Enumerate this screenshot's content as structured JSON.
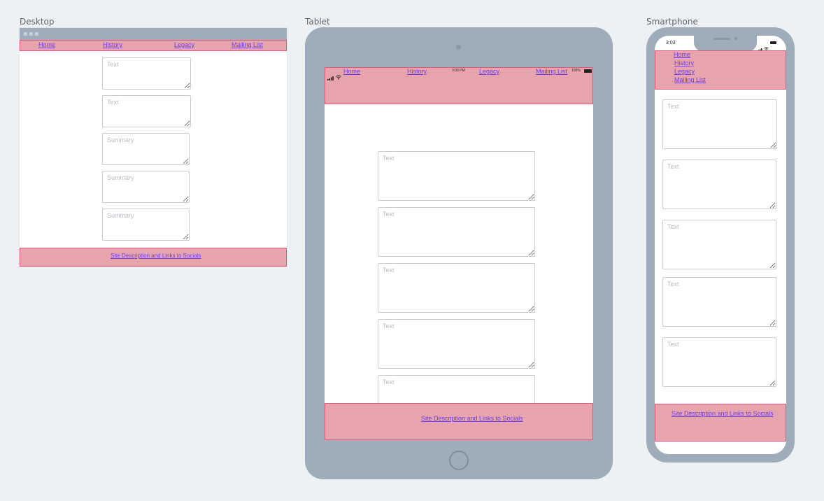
{
  "labels": {
    "desktop": "Desktop",
    "tablet": "Tablet",
    "smartphone": "Smartphone"
  },
  "nav": {
    "home": "Home",
    "history": "History",
    "legacy": "Legacy",
    "mailing_list": "Mailing List"
  },
  "footer_link": "Site Description and Links to Socials",
  "desktop": {
    "placeholders": [
      "Text",
      "Text",
      "Summary",
      "Summary",
      "Summary"
    ]
  },
  "tablet": {
    "status_time": "3:03 PM",
    "battery": "100%",
    "placeholders": [
      "Text",
      "Text",
      "Text",
      "Text",
      "Text"
    ]
  },
  "phone": {
    "status_time": "3:03",
    "placeholders": [
      "Text",
      "Text",
      "Text",
      "Text",
      "Text"
    ]
  },
  "colors": {
    "background": "#eef1f4",
    "device_gray": "#9eadb9",
    "nav_pink": "#e8a4ac",
    "nav_border": "#e0587a",
    "link": "#6a3cf5"
  }
}
